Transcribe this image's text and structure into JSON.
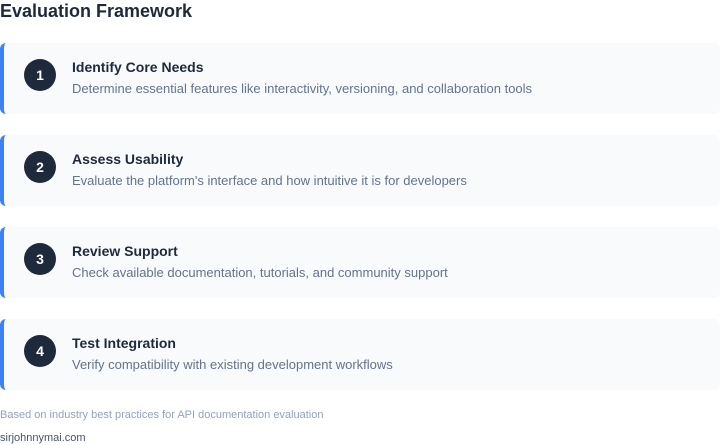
{
  "title": "Evaluation Framework",
  "steps": [
    {
      "number": "1",
      "title": "Identify Core Needs",
      "description": "Determine essential features like interactivity, versioning, and collaboration tools"
    },
    {
      "number": "2",
      "title": "Assess Usability",
      "description": "Evaluate the platform's interface and how intuitive it is for developers"
    },
    {
      "number": "3",
      "title": "Review Support",
      "description": "Check available documentation, tutorials, and community support"
    },
    {
      "number": "4",
      "title": "Test Integration",
      "description": "Verify compatibility with existing development workflows"
    }
  ],
  "footnote": "Based on industry best practices for API documentation evaluation",
  "credit": "sirjohnnymai.com",
  "colors": {
    "accent": "#3b82f6",
    "badge": "#1e293b",
    "card_background": "#f8fafc"
  }
}
